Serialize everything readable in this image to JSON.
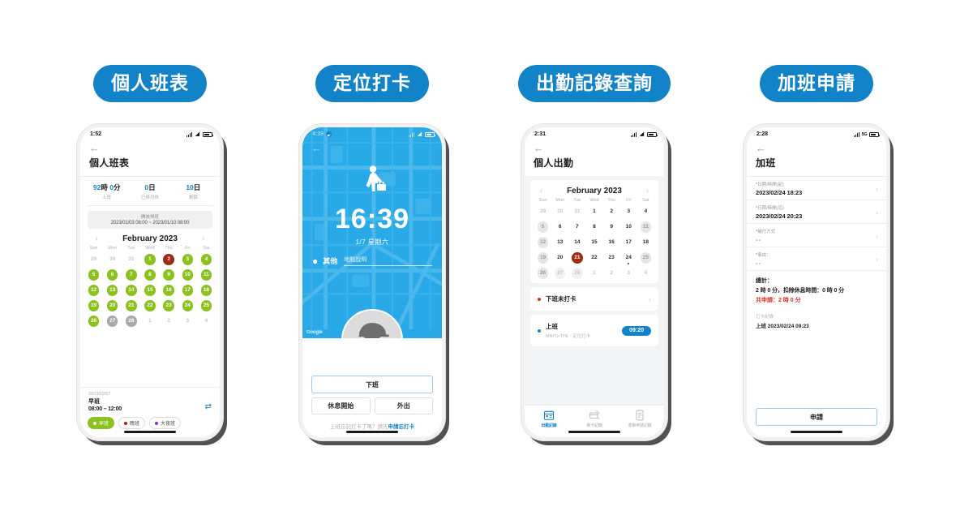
{
  "columns": [
    {
      "badge": "個人班表",
      "status": {
        "time": "1:52",
        "network": "",
        "icons": [
          "signal-bars",
          "wifi",
          "battery"
        ]
      },
      "app_title": "個人班表",
      "back_icon": "←",
      "stats": [
        {
          "value_num": "92",
          "value_unit": "時",
          "value_num2": "0",
          "value_unit2": "分",
          "label": "上班"
        },
        {
          "value_num": "0",
          "value_unit": "日",
          "label": "已排月休"
        },
        {
          "value_num": "10",
          "value_unit": "日",
          "label": "剩餘"
        }
      ],
      "open_shift": {
        "title": "開放排班",
        "range": "2023/01/03 08:00 ~ 2023/01/10 08:00"
      },
      "calendar": {
        "month": "February 2023",
        "prev_icon": "‹",
        "next_icon": "›",
        "weekdays": [
          "Sun",
          "Mon",
          "Tue",
          "Wed",
          "Thu",
          "Fri",
          "Sat"
        ],
        "cells": [
          {
            "d": "29",
            "s": "mute"
          },
          {
            "d": "30",
            "s": "mute"
          },
          {
            "d": "31",
            "s": "mute"
          },
          {
            "d": "1",
            "s": "green"
          },
          {
            "d": "2",
            "s": "red"
          },
          {
            "d": "3",
            "s": "green"
          },
          {
            "d": "4",
            "s": "green"
          },
          {
            "d": "5",
            "s": "green"
          },
          {
            "d": "6",
            "s": "green"
          },
          {
            "d": "7",
            "s": "green"
          },
          {
            "d": "8",
            "s": "green"
          },
          {
            "d": "9",
            "s": "green"
          },
          {
            "d": "10",
            "s": "green"
          },
          {
            "d": "11",
            "s": "green"
          },
          {
            "d": "12",
            "s": "green"
          },
          {
            "d": "13",
            "s": "green"
          },
          {
            "d": "14",
            "s": "green"
          },
          {
            "d": "15",
            "s": "green"
          },
          {
            "d": "16",
            "s": "green"
          },
          {
            "d": "17",
            "s": "green"
          },
          {
            "d": "18",
            "s": "green"
          },
          {
            "d": "19",
            "s": "green"
          },
          {
            "d": "20",
            "s": "green"
          },
          {
            "d": "21",
            "s": "green"
          },
          {
            "d": "22",
            "s": "green"
          },
          {
            "d": "23",
            "s": "green"
          },
          {
            "d": "24",
            "s": "green"
          },
          {
            "d": "25",
            "s": "green"
          },
          {
            "d": "26",
            "s": "green"
          },
          {
            "d": "27",
            "s": "gray"
          },
          {
            "d": "28",
            "s": "gray"
          },
          {
            "d": "1",
            "s": "mute"
          },
          {
            "d": "2",
            "s": "mute"
          },
          {
            "d": "3",
            "s": "mute"
          },
          {
            "d": "4",
            "s": "mute"
          }
        ]
      },
      "shift_detail": {
        "date": "2023/02/07",
        "name": "早班",
        "hours": "08:00 – 12:00",
        "swap_icon": "⇄"
      },
      "legend": [
        {
          "label": "早班",
          "color": "#8cc220",
          "active": true
        },
        {
          "label": "晚班",
          "color": "#a3290f",
          "active": false
        },
        {
          "label": "大夜班",
          "color": "#8b2fd6",
          "active": false
        }
      ]
    },
    {
      "badge": "定位打卡",
      "status": {
        "time": "4:39",
        "network": "",
        "icons": [
          "location-arrow",
          "signal-bars",
          "wifi",
          "battery"
        ]
      },
      "back_icon": "←",
      "punch": {
        "time": "16:39",
        "date": "1/7 星期六",
        "location_name": "其他",
        "location_desc": "地點說明",
        "pin_icon": "📍",
        "watermark": "Google"
      },
      "buttons": {
        "primary": "下班",
        "secondary": [
          "休息開始",
          "外出"
        ]
      },
      "forgot": {
        "prefix": "上班忘記打卡了嗎？請先",
        "link": "申請忘打卡"
      }
    },
    {
      "badge": "出勤記錄查詢",
      "status": {
        "time": "2:31",
        "network": "",
        "icons": [
          "signal-bars",
          "wifi",
          "battery"
        ]
      },
      "app_title": "個人出勤",
      "back_icon": "←",
      "calendar": {
        "month": "February 2023",
        "prev_icon": "‹",
        "next_icon": "›",
        "weekdays": [
          "Sun",
          "Mon",
          "Tue",
          "Wed",
          "Thu",
          "Fri",
          "Sat"
        ],
        "cells": [
          {
            "d": "29",
            "s": "mute"
          },
          {
            "d": "30",
            "s": "mute"
          },
          {
            "d": "31",
            "s": "mute"
          },
          {
            "d": "1",
            "s": "plain"
          },
          {
            "d": "2",
            "s": "plain"
          },
          {
            "d": "3",
            "s": "plain"
          },
          {
            "d": "4",
            "s": "plain"
          },
          {
            "d": "5",
            "s": "lgray"
          },
          {
            "d": "6",
            "s": "plain"
          },
          {
            "d": "7",
            "s": "plain"
          },
          {
            "d": "8",
            "s": "plain"
          },
          {
            "d": "9",
            "s": "plain"
          },
          {
            "d": "10",
            "s": "plain"
          },
          {
            "d": "11",
            "s": "lgray"
          },
          {
            "d": "12",
            "s": "lgray"
          },
          {
            "d": "13",
            "s": "plain"
          },
          {
            "d": "14",
            "s": "plain"
          },
          {
            "d": "15",
            "s": "plain"
          },
          {
            "d": "16",
            "s": "plain"
          },
          {
            "d": "17",
            "s": "plain"
          },
          {
            "d": "18",
            "s": "plain"
          },
          {
            "d": "19",
            "s": "lgray"
          },
          {
            "d": "20",
            "s": "plain"
          },
          {
            "d": "21",
            "s": "red"
          },
          {
            "d": "22",
            "s": "plain"
          },
          {
            "d": "23",
            "s": "plain"
          },
          {
            "d": "24",
            "s": "plain",
            "marker": true
          },
          {
            "d": "25",
            "s": "lgray"
          },
          {
            "d": "26",
            "s": "lgray"
          },
          {
            "d": "27",
            "s": "lgraymute"
          },
          {
            "d": "28",
            "s": "lgraymute"
          },
          {
            "d": "1",
            "s": "mute"
          },
          {
            "d": "2",
            "s": "mute"
          },
          {
            "d": "3",
            "s": "mute"
          },
          {
            "d": "4",
            "s": "mute"
          }
        ]
      },
      "records": [
        {
          "title": "下班未打卡",
          "subtitle": "",
          "dot": "#d93025",
          "chevron": "›",
          "badge": ""
        },
        {
          "title": "上班",
          "subtitle": "MAYO-TPE - 定位打卡",
          "dot": "#1283c8",
          "chevron": "",
          "badge": "09:20"
        }
      ],
      "tabs": [
        {
          "label": "出勤記錄",
          "icon": "calendar-card-icon",
          "active": true
        },
        {
          "label": "刷卡紀錄",
          "icon": "card-swipe-icon",
          "active": false
        },
        {
          "label": "表單申請記錄",
          "icon": "form-icon",
          "active": false
        }
      ]
    },
    {
      "badge": "加班申請",
      "status": {
        "time": "2:28",
        "network": "5G",
        "icons": [
          "signal-bars",
          "5g",
          "battery"
        ]
      },
      "app_title": "加班",
      "back_icon": "←",
      "fields": [
        {
          "required": "*",
          "label": "日期/時間(起)",
          "value": "2023/02/24 18:23",
          "chevron": "›",
          "dim": false
        },
        {
          "required": "*",
          "label": "日期/時間(迄)",
          "value": "2023/02/24 20:23",
          "chevron": "›",
          "dim": false
        },
        {
          "required": "*",
          "label": "補付方式",
          "value": "--",
          "chevron": "›",
          "dim": true
        },
        {
          "required": "*",
          "label": "事由：",
          "value": "--",
          "chevron": "›",
          "dim": true
        }
      ],
      "totals": {
        "title": "總計：",
        "line_prefix": "",
        "hours": "2",
        "hours_unit": "時",
        "mins": "0",
        "mins_unit": "分",
        "break_label": "，扣除休息時間：",
        "break_hours": "0",
        "break_mins": "0",
        "applied": "共申請：2 時 0 分",
        "line2_full": "2 時 0 分，扣除休息時間：0 時 0 分"
      },
      "punch_log": {
        "title": "打卡紀錄",
        "entry": "上班 2023/02/24 09:23"
      },
      "submit": "申請"
    }
  ]
}
